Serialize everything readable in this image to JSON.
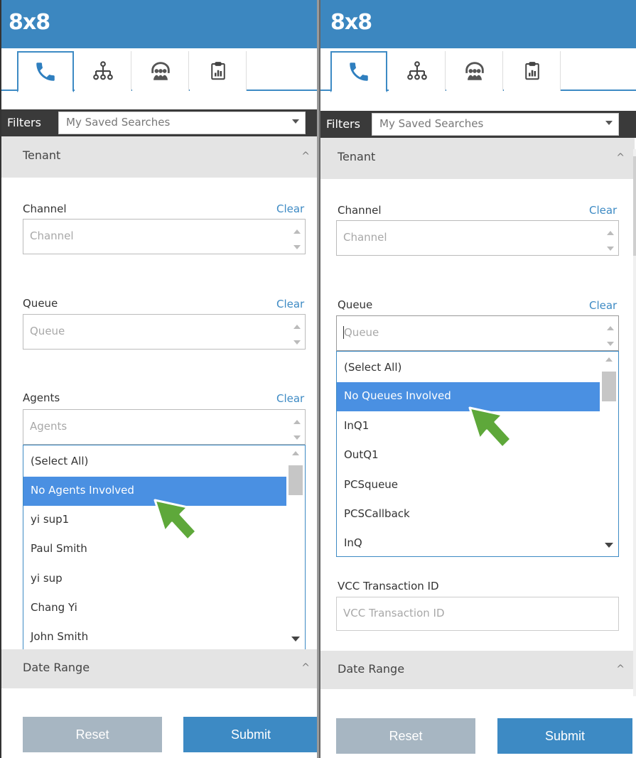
{
  "app": {
    "logo": "8x8"
  },
  "icons": {
    "tabs": [
      "phone-icon",
      "org-hierarchy-icon",
      "agents-headset-icon",
      "clipboard-report-icon"
    ],
    "accent": "#3d8ac4",
    "cursor": "green-arrow-cursor-icon"
  },
  "filterbar": {
    "label": "Filters",
    "saved_searches_placeholder": "My Saved Searches"
  },
  "left": {
    "sections": {
      "tenant": "Tenant",
      "date_range": "Date Range"
    },
    "channel": {
      "label": "Channel",
      "clear": "Clear",
      "placeholder": "Channel"
    },
    "queue": {
      "label": "Queue",
      "clear": "Clear",
      "placeholder": "Queue"
    },
    "agents": {
      "label": "Agents",
      "clear": "Clear",
      "placeholder": "Agents",
      "options": [
        "(Select All)",
        "No Agents Involved",
        "yi sup1",
        "Paul Smith",
        "yi sup",
        "Chang Yi",
        "John Smith"
      ],
      "selected": "No Agents Involved"
    },
    "buttons": {
      "reset": "Reset",
      "submit": "Submit"
    }
  },
  "right": {
    "sections": {
      "tenant": "Tenant",
      "date_range": "Date Range"
    },
    "channel": {
      "label": "Channel",
      "clear": "Clear",
      "placeholder": "Channel"
    },
    "queue": {
      "label": "Queue",
      "clear": "Clear",
      "placeholder": "Queue",
      "options": [
        "(Select All)",
        "No Queues Involved",
        "InQ1",
        "OutQ1",
        "PCSqueue",
        "PCSCallback",
        "InQ"
      ],
      "selected": "No Queues Involved"
    },
    "vcc": {
      "label": "VCC Transaction ID",
      "placeholder": "VCC Transaction ID"
    },
    "buttons": {
      "reset": "Reset",
      "submit": "Submit"
    }
  }
}
